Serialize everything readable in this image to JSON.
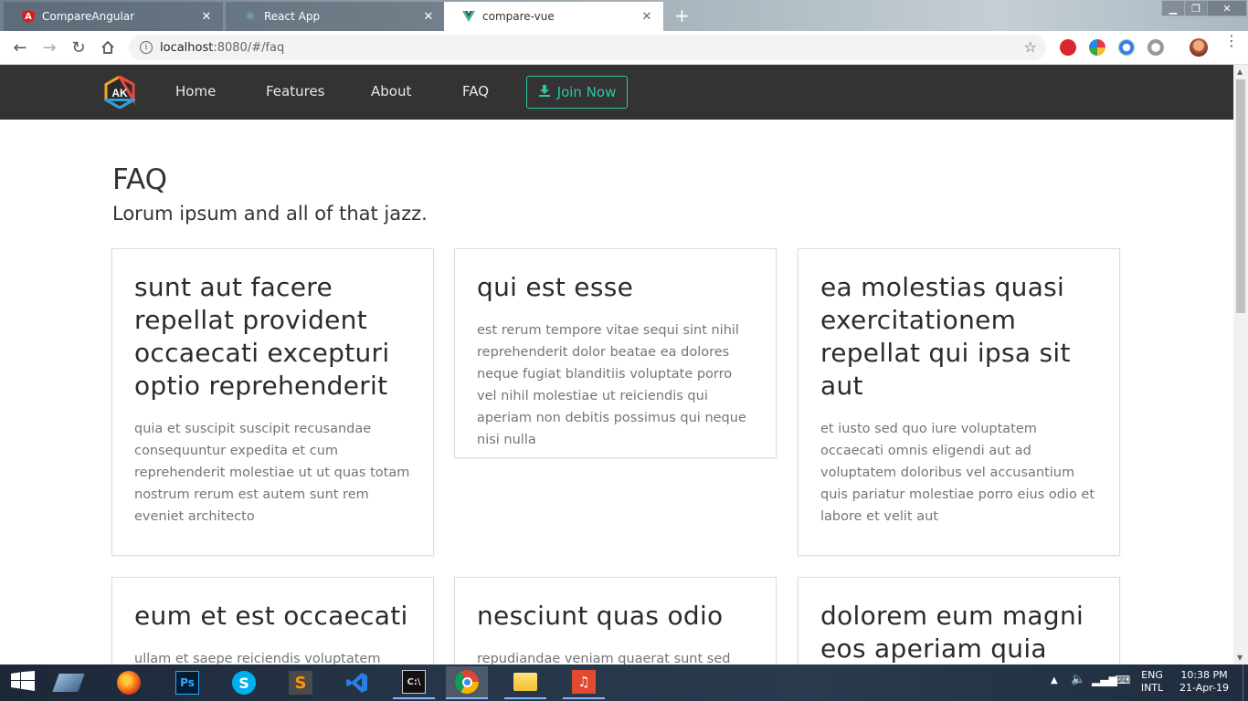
{
  "browser": {
    "tabs": [
      {
        "title": "CompareAngular",
        "icon": "angular-icon",
        "active": false
      },
      {
        "title": "React App",
        "icon": "react-icon",
        "active": false
      },
      {
        "title": "compare-vue",
        "icon": "vue-icon",
        "active": true
      }
    ],
    "url_host": "localhost",
    "url_path": ":8080/#/faq"
  },
  "site": {
    "logo_text": "AK",
    "nav": [
      "Home",
      "Features",
      "About",
      "FAQ"
    ],
    "join_label": "Join Now",
    "accent_color": "#2ec4a6",
    "navbar_color": "#333333"
  },
  "page": {
    "title": "FAQ",
    "subtitle": "Lorum ipsum and all of that jazz."
  },
  "cards": [
    {
      "title": "sunt aut facere repellat provident occaecati excepturi optio reprehenderit",
      "body": "quia et suscipit suscipit recusandae consequuntur expedita et cum reprehenderit molestiae ut ut quas totam nostrum rerum est autem sunt rem eveniet architecto"
    },
    {
      "title": "qui est esse",
      "body": "est rerum tempore vitae sequi sint nihil reprehenderit dolor beatae ea dolores neque fugiat blanditiis voluptate porro vel nihil molestiae ut reiciendis qui aperiam non debitis possimus qui neque nisi nulla"
    },
    {
      "title": "ea molestias quasi exercitationem repellat qui ipsa sit aut",
      "body": "et iusto sed quo iure voluptatem occaecati omnis eligendi aut ad voluptatem doloribus vel accusantium quis pariatur molestiae porro eius odio et labore et velit aut"
    },
    {
      "title": "eum et est occaecati",
      "body": "ullam et saepe reiciendis voluptatem"
    },
    {
      "title": "nesciunt quas odio",
      "body": "repudiandae veniam quaerat sunt sed alias"
    },
    {
      "title": "dolorem eum magni eos aperiam quia",
      "body": ""
    }
  ],
  "taskbar": {
    "apps": [
      "start-icon",
      "task-view-icon",
      "firefox-icon",
      "photoshop-icon",
      "skype-icon",
      "sublime-text-icon",
      "vscode-icon",
      "terminal-icon",
      "chrome-icon",
      "file-explorer-icon",
      "music-icon"
    ],
    "lang_top": "ENG",
    "lang_bottom": "INTL",
    "time": "10:38 PM",
    "date": "21-Apr-19"
  }
}
